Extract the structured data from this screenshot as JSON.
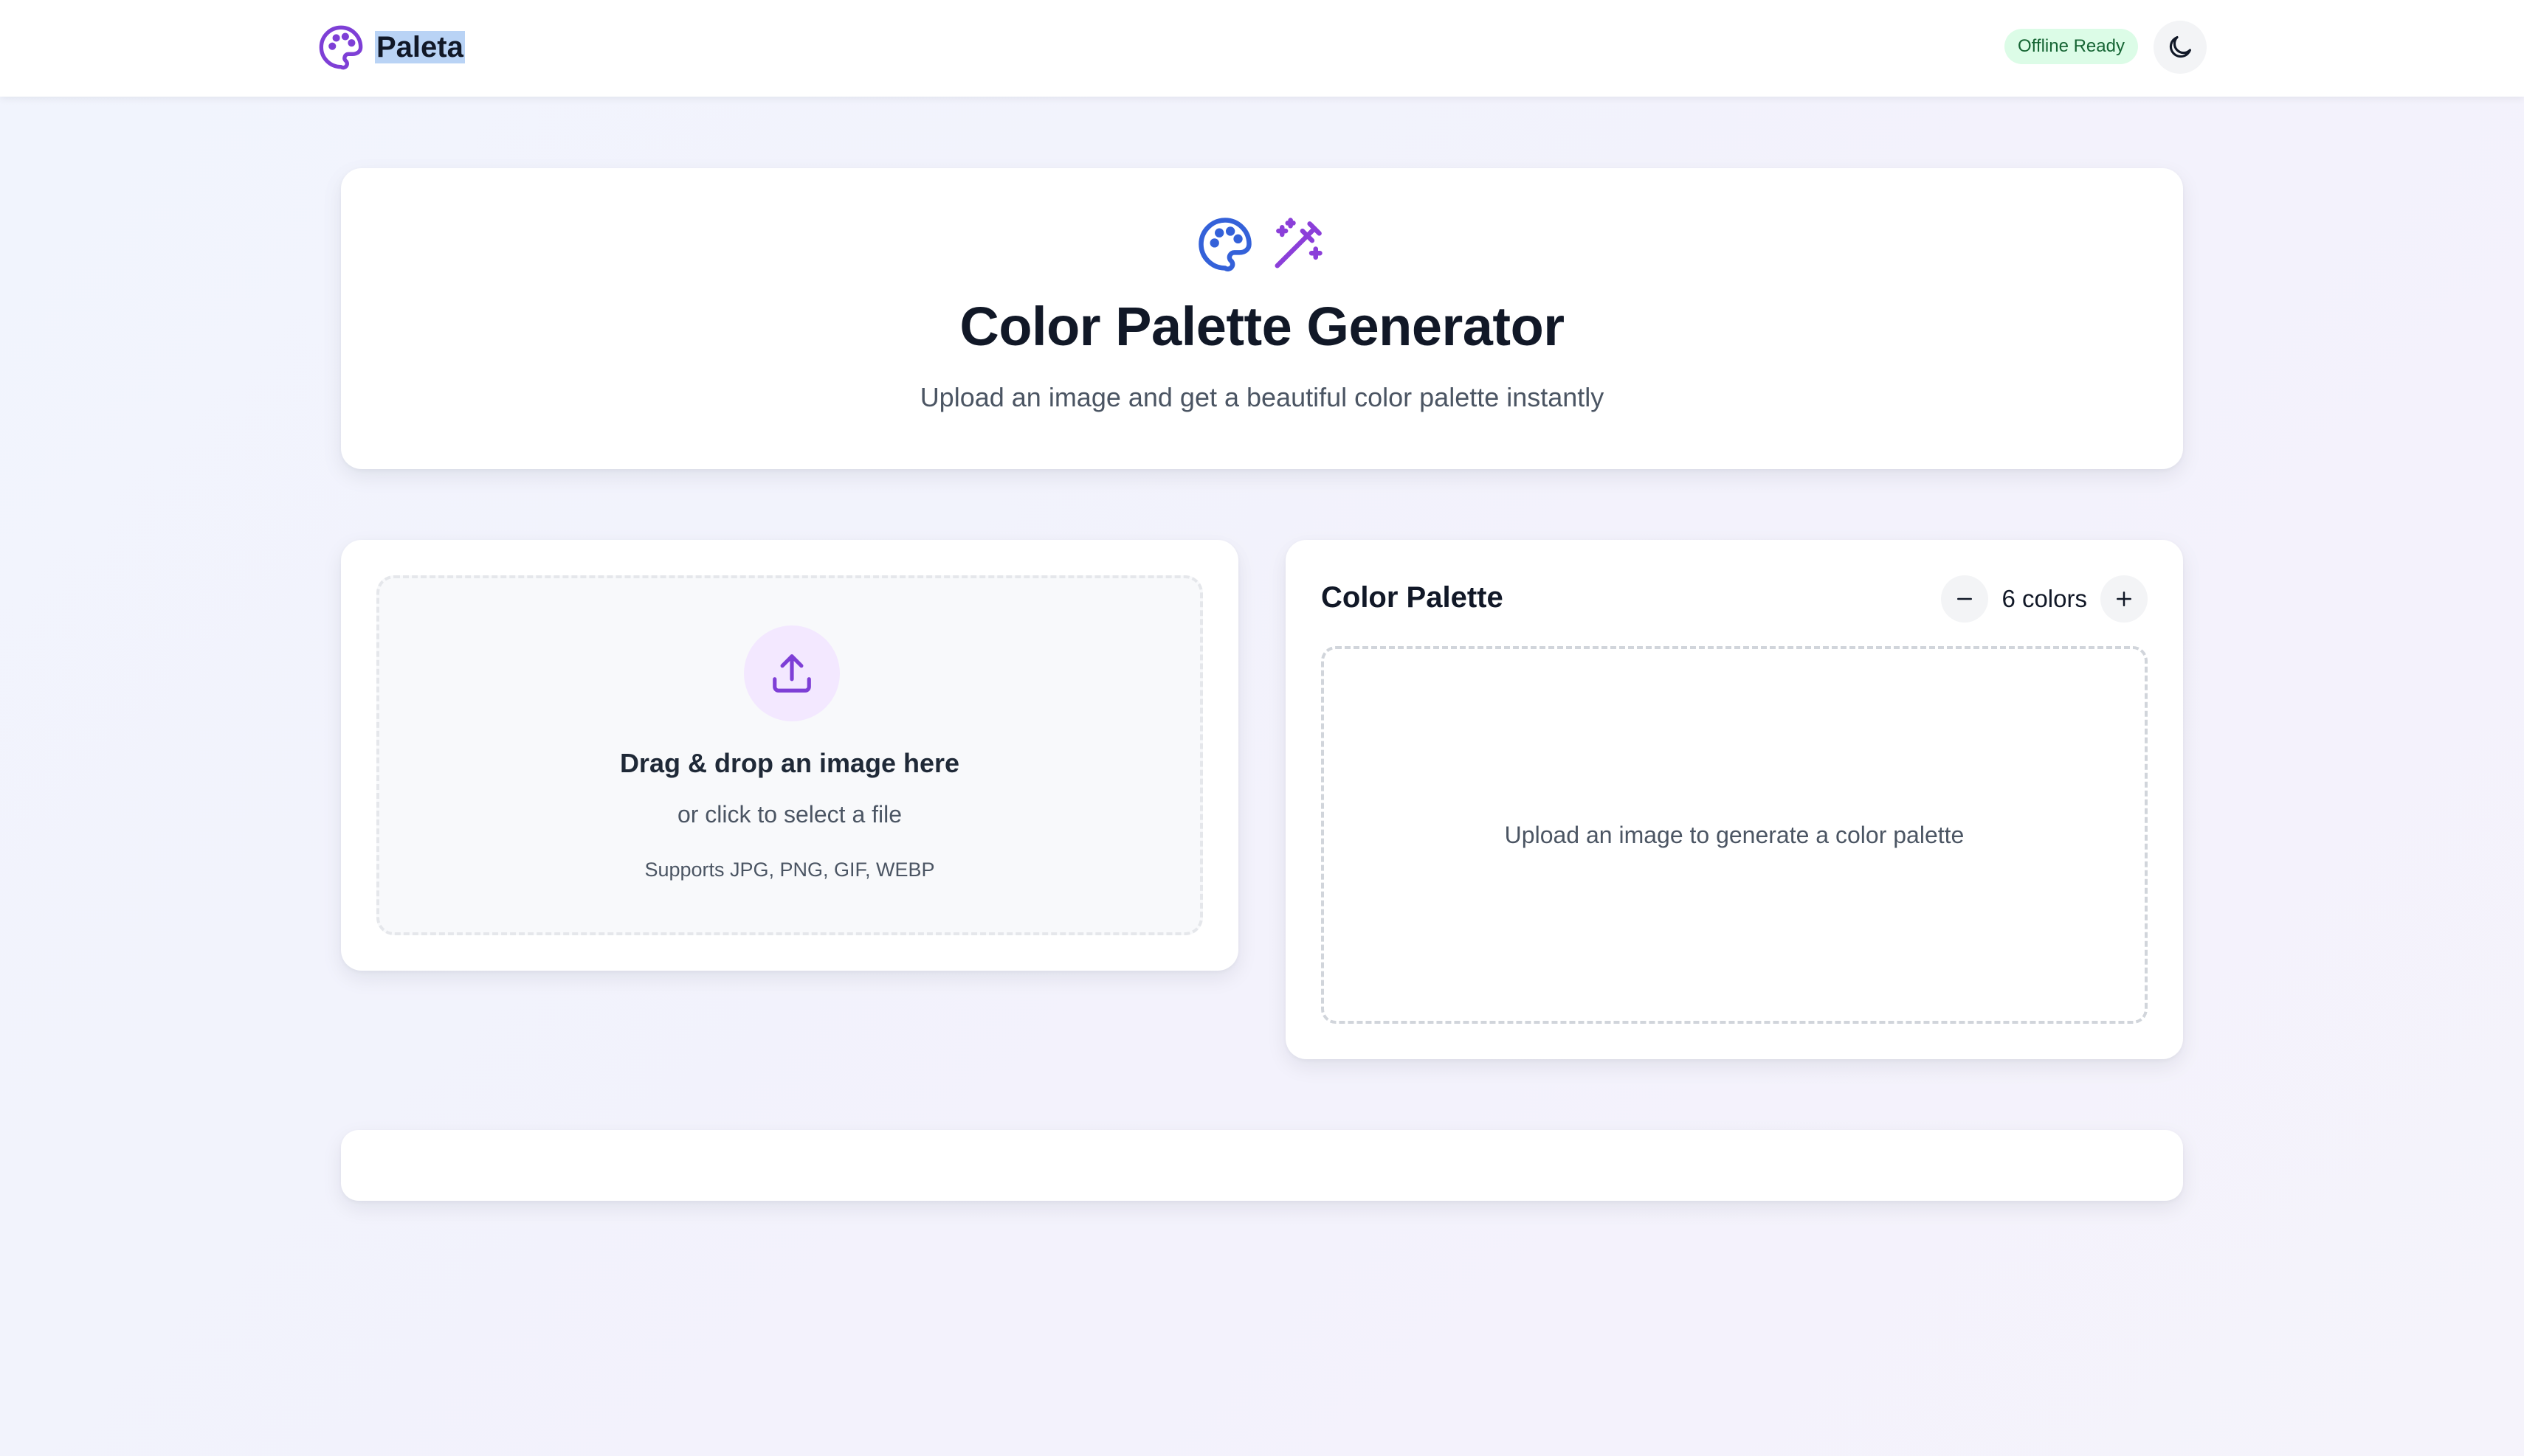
{
  "header": {
    "brand_name": "Paleta",
    "brand_icon": "palette-icon",
    "status_badge": "Offline Ready",
    "theme_toggle_icon": "moon-icon"
  },
  "hero": {
    "icons": [
      "palette-icon",
      "magic-wand-icon"
    ],
    "title": "Color Palette Generator",
    "subtitle": "Upload an image and get a beautiful color palette instantly"
  },
  "upload": {
    "icon": "upload-icon",
    "title": "Drag & drop an image here",
    "subtitle": "or click to select a file",
    "formats": "Supports JPG, PNG, GIF, WEBP"
  },
  "palette": {
    "title": "Color Palette",
    "count_label": "6 colors",
    "decrease_icon": "minus-icon",
    "increase_icon": "plus-icon",
    "empty_message": "Upload an image to generate a color palette"
  },
  "colors": {
    "brand_purple": "#7e3fd6",
    "hero_blue": "#3461d9",
    "badge_bg": "#dcfce7",
    "badge_text": "#166534",
    "upload_circle_bg": "#f3e8ff"
  }
}
